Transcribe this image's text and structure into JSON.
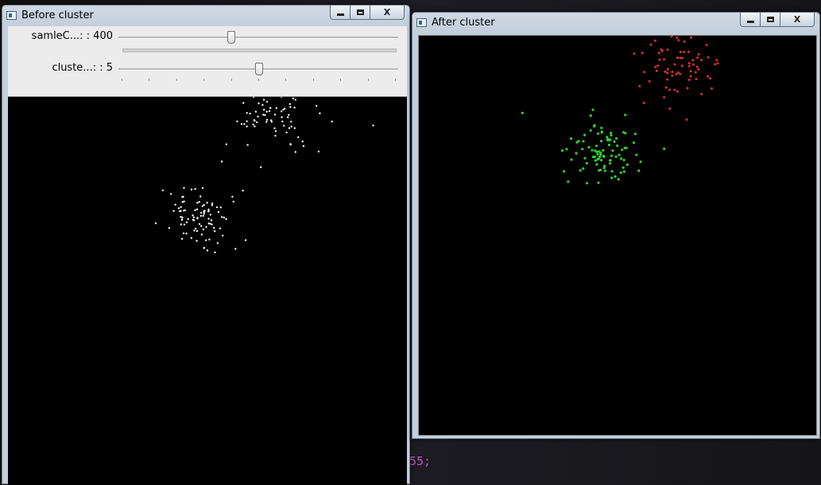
{
  "background": {
    "code_fragment": "55;"
  },
  "before_window": {
    "title": "Before cluster",
    "controls": {
      "minimize": "minimize",
      "maximize": "maximize",
      "close": "X"
    },
    "trackbars": [
      {
        "label": "samleC...: : 400",
        "value": 400,
        "position_fraction": 0.4
      },
      {
        "label": "cluste...: : 5",
        "value": 5,
        "position_fraction": 0.5,
        "tick_count": 11
      }
    ],
    "point_color": "#ffffff"
  },
  "after_window": {
    "title": "After cluster",
    "controls": {
      "minimize": "minimize",
      "maximize": "maximize",
      "close": "X"
    },
    "cluster_colors": [
      "#e03030",
      "#30d030"
    ]
  }
}
